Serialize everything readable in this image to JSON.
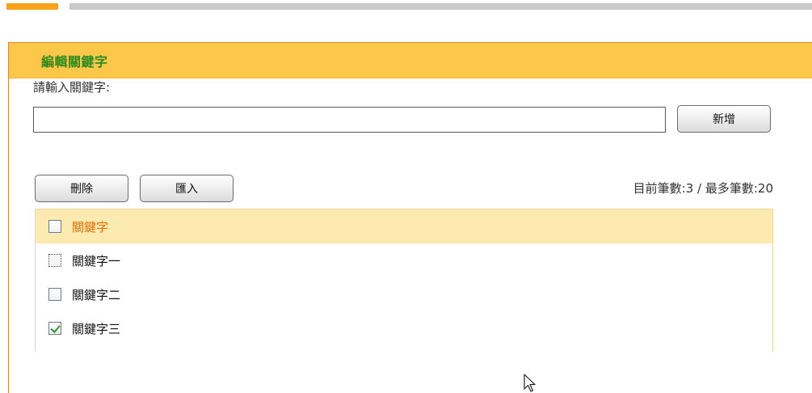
{
  "panel": {
    "title": "編輯關鍵字"
  },
  "form": {
    "prompt_label": "請輸入關鍵字:",
    "input_value": "",
    "input_placeholder": "",
    "add_button": "新增"
  },
  "toolbar": {
    "delete_button": "刪除",
    "import_button": "匯入",
    "count_info": "目前筆數:3 / 最多筆數:20"
  },
  "keywords": {
    "items": [
      {
        "label": "關鍵字",
        "checked": false
      },
      {
        "label": "關鍵字一",
        "checked": false
      },
      {
        "label": "關鍵字二",
        "checked": false
      },
      {
        "label": "關鍵字三",
        "checked": true
      }
    ]
  },
  "colors": {
    "header_bg": "#fdc74a",
    "title_green": "#2e8b1f",
    "panel_border": "#e38a2b",
    "highlight_row": "#fdeab0",
    "highlight_text": "#e26f00"
  }
}
